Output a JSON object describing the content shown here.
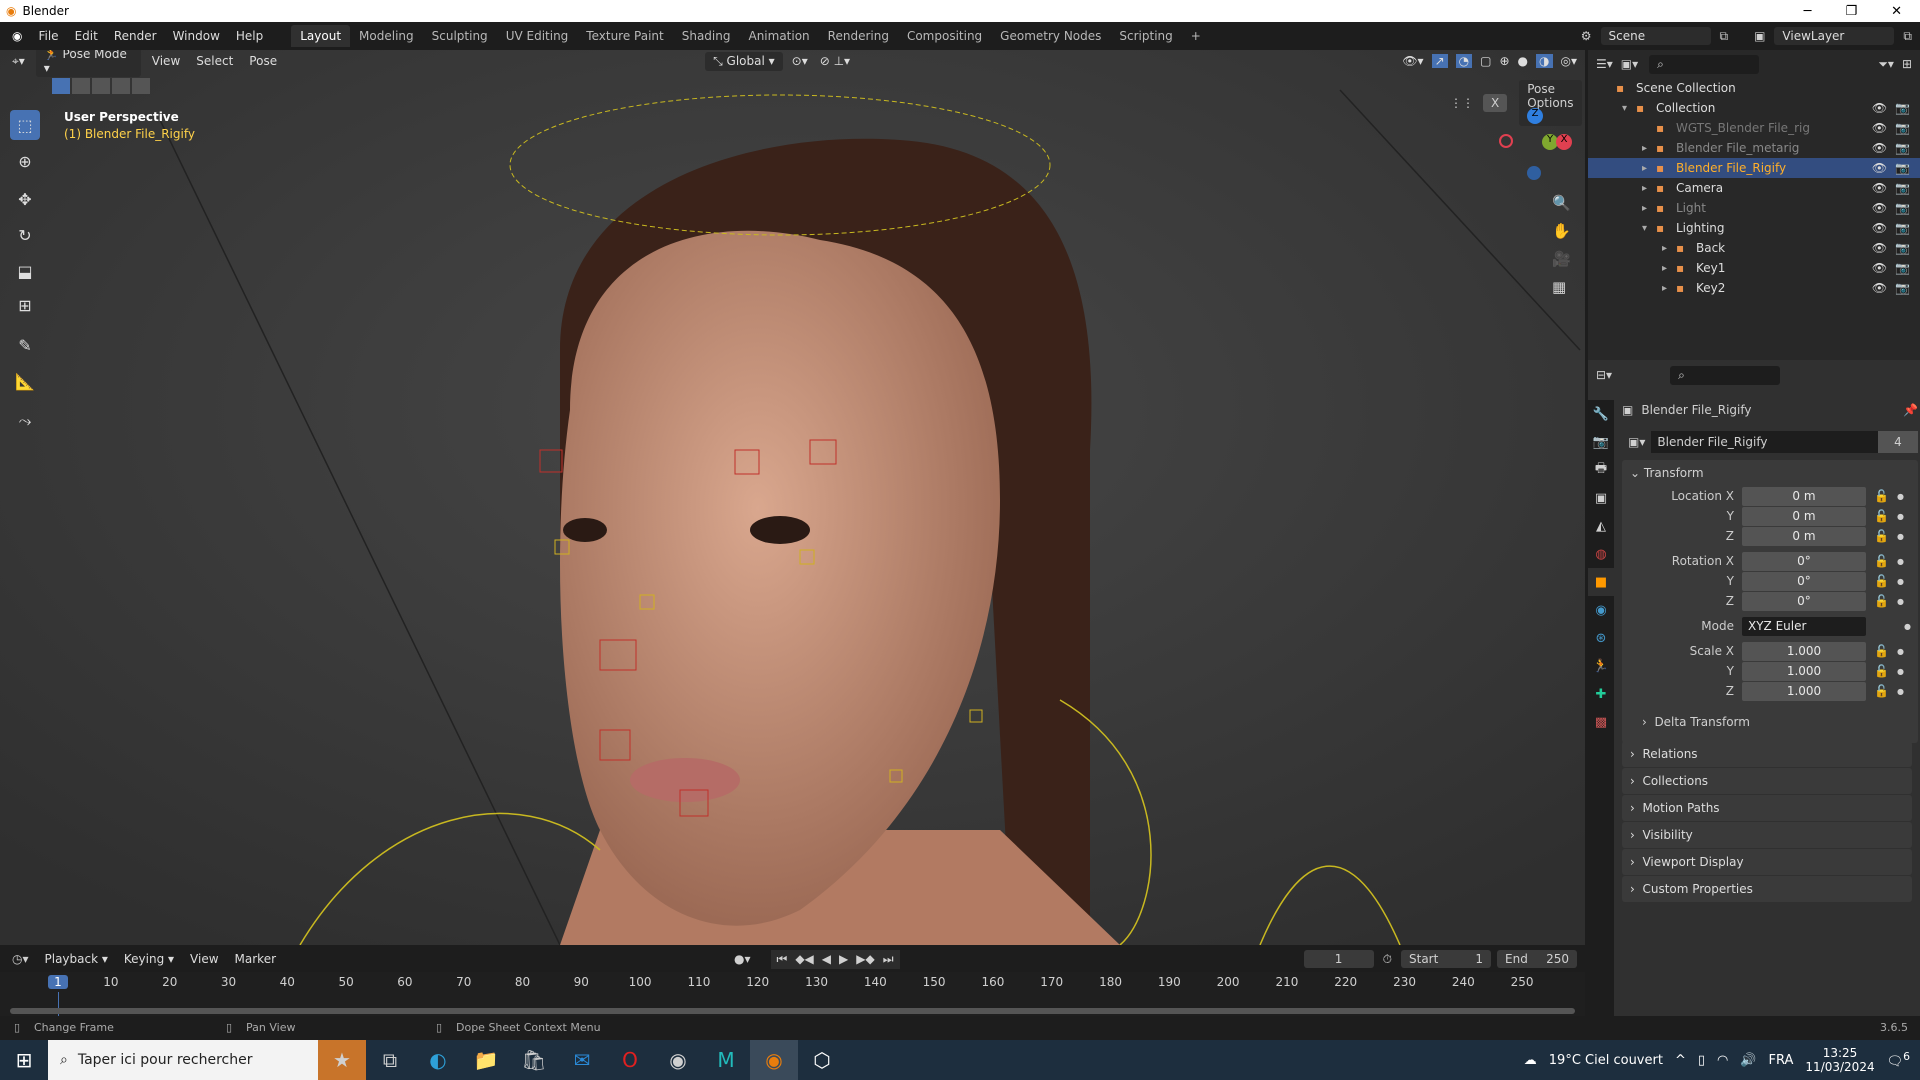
{
  "window": {
    "title": "Blender",
    "minimize": "─",
    "maximize": "❐",
    "close": "✕"
  },
  "menus": [
    "File",
    "Edit",
    "Render",
    "Window",
    "Help"
  ],
  "workspaces": [
    "Layout",
    "Modeling",
    "Sculpting",
    "UV Editing",
    "Texture Paint",
    "Shading",
    "Animation",
    "Rendering",
    "Compositing",
    "Geometry Nodes",
    "Scripting",
    "+"
  ],
  "scene": {
    "name": "Scene",
    "view_layer": "ViewLayer"
  },
  "viewport": {
    "mode": "Pose Mode",
    "menus": [
      "View",
      "Select",
      "Pose"
    ],
    "orientation": "Global",
    "pose_options": "Pose Options",
    "x_mirror": "X",
    "perspective": "User Perspective",
    "object_label": "(1) Blender File_Rigify",
    "gizmo": {
      "z": "Z",
      "y": "Y",
      "x": "X"
    }
  },
  "outliner": {
    "items": [
      {
        "name": "Scene Collection",
        "indent": 0,
        "color": "#dddddd"
      },
      {
        "name": "Collection",
        "indent": 1,
        "color": "#dddddd"
      },
      {
        "name": "WGTS_Blender File_rig",
        "indent": 2,
        "color": "#777777"
      },
      {
        "name": "Blender File_metarig",
        "indent": 2,
        "color": "#888888"
      },
      {
        "name": "Blender File_Rigify",
        "indent": 2,
        "color": "#ffaf29",
        "selected": true
      },
      {
        "name": "Camera",
        "indent": 2,
        "color": "#dddddd"
      },
      {
        "name": "Light",
        "indent": 2,
        "color": "#888888"
      },
      {
        "name": "Lighting",
        "indent": 2,
        "color": "#dddddd"
      },
      {
        "name": "Back",
        "indent": 3,
        "color": "#dddddd"
      },
      {
        "name": "Key1",
        "indent": 3,
        "color": "#dddddd"
      },
      {
        "name": "Key2",
        "indent": 3,
        "color": "#dddddd"
      }
    ]
  },
  "properties": {
    "object_name": "Blender File_Rigify",
    "data_name": "Blender File_Rigify",
    "users": "4",
    "transform_label": "Transform",
    "location": {
      "label": "Location X",
      "x": "0 m",
      "y": "0 m",
      "z": "0 m"
    },
    "rotation": {
      "label": "Rotation X",
      "x": "0°",
      "y": "0°",
      "z": "0°"
    },
    "mode": {
      "label": "Mode",
      "value": "XYZ Euler"
    },
    "scale": {
      "label": "Scale X",
      "x": "1.000",
      "y": "1.000",
      "z": "1.000"
    },
    "axis": {
      "y": "Y",
      "z": "Z"
    },
    "delta": "Delta Transform",
    "panels": [
      "Relations",
      "Collections",
      "Motion Paths",
      "Visibility",
      "Viewport Display",
      "Custom Properties"
    ]
  },
  "timeline": {
    "menus": [
      "Playback",
      "Keying",
      "View",
      "Marker"
    ],
    "current_frame": "1",
    "start_label": "Start",
    "start": "1",
    "end_label": "End",
    "end": "250",
    "ticks": [
      "1",
      "10",
      "20",
      "30",
      "40",
      "50",
      "60",
      "70",
      "80",
      "90",
      "100",
      "110",
      "120",
      "130",
      "140",
      "150",
      "160",
      "170",
      "180",
      "190",
      "200",
      "210",
      "220",
      "230",
      "240",
      "250"
    ]
  },
  "status": {
    "hints": [
      "Change Frame",
      "Pan View",
      "Dope Sheet Context Menu"
    ],
    "version": "3.6.5"
  },
  "taskbar": {
    "search_placeholder": "Taper ici pour rechercher",
    "weather": "19°C  Ciel couvert",
    "language": "FRA",
    "time": "13:25",
    "date": "11/03/2024",
    "notifications": "6"
  }
}
